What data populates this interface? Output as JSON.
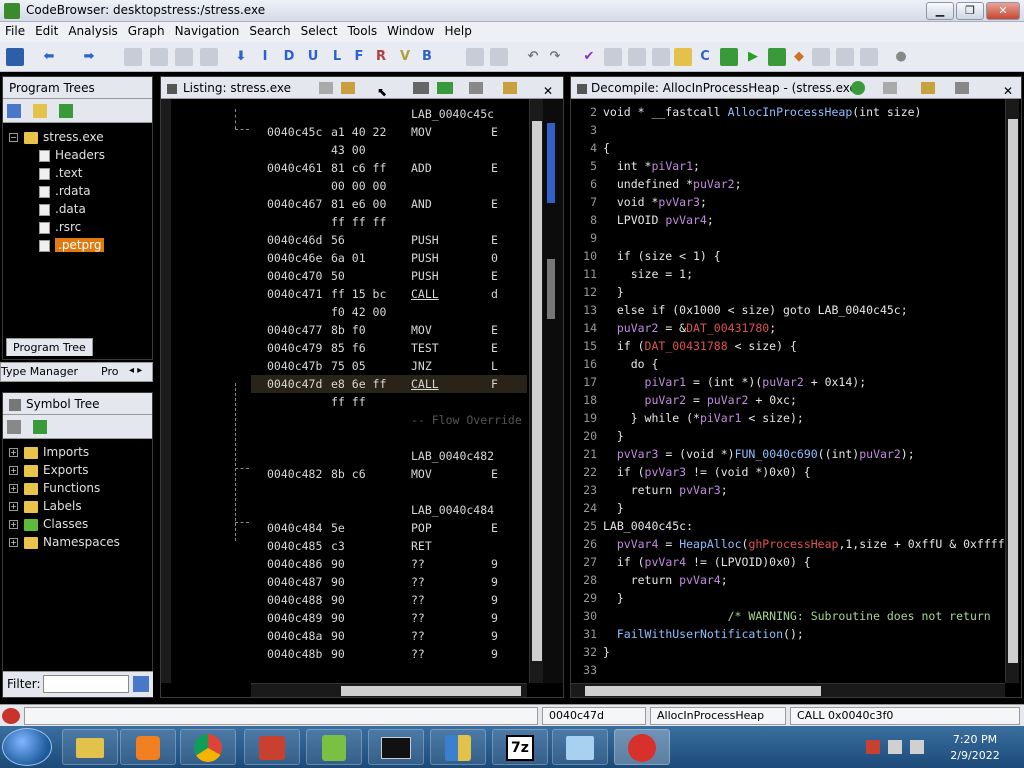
{
  "window": {
    "title": "CodeBrowser: desktopstress:/stress.exe",
    "min": "▁",
    "max": "❐",
    "close": "✕"
  },
  "menu": [
    "File",
    "Edit",
    "Analysis",
    "Graph",
    "Navigation",
    "Search",
    "Select",
    "Tools",
    "Window",
    "Help"
  ],
  "toolbar_letters": [
    "I",
    "D",
    "U",
    "L",
    "F",
    "R",
    "V",
    "B"
  ],
  "program_trees": {
    "title": "Program Trees",
    "root": "stress.exe",
    "items": [
      "Headers",
      ".text",
      ".rdata",
      ".data",
      ".rsrc",
      ".petprg"
    ],
    "tab": "Program Tree"
  },
  "type_manager": {
    "tab1": "Type Manager",
    "tab2": "Pro"
  },
  "symbol_tree": {
    "title": "Symbol Tree",
    "items": [
      "Imports",
      "Exports",
      "Functions",
      "Labels",
      "Classes",
      "Namespaces"
    ],
    "filter_label": "Filter:"
  },
  "listing": {
    "title": "Listing:  stress.exe",
    "rows": [
      {
        "addr": "",
        "bytes": "",
        "mnem": "LAB_0040c45c",
        "op": "",
        "label": true
      },
      {
        "addr": "0040c45c",
        "bytes": "a1 40 22",
        "mnem": "MOV",
        "op": "E"
      },
      {
        "addr": "",
        "bytes": "43 00",
        "mnem": "",
        "op": ""
      },
      {
        "addr": "0040c461",
        "bytes": "81 c6 ff",
        "mnem": "ADD",
        "op": "E"
      },
      {
        "addr": "",
        "bytes": "00 00 00",
        "mnem": "",
        "op": ""
      },
      {
        "addr": "0040c467",
        "bytes": "81 e6 00",
        "mnem": "AND",
        "op": "E"
      },
      {
        "addr": "",
        "bytes": "ff ff ff",
        "mnem": "",
        "op": ""
      },
      {
        "addr": "0040c46d",
        "bytes": "56",
        "mnem": "PUSH",
        "op": "E"
      },
      {
        "addr": "0040c46e",
        "bytes": "6a 01",
        "mnem": "PUSH",
        "op": "0"
      },
      {
        "addr": "0040c470",
        "bytes": "50",
        "mnem": "PUSH",
        "op": "E"
      },
      {
        "addr": "0040c471",
        "bytes": "ff 15 bc",
        "mnem": "CALL",
        "op": "d"
      },
      {
        "addr": "",
        "bytes": "f0 42 00",
        "mnem": "",
        "op": ""
      },
      {
        "addr": "0040c477",
        "bytes": "8b f0",
        "mnem": "MOV",
        "op": "E"
      },
      {
        "addr": "0040c479",
        "bytes": "85 f6",
        "mnem": "TEST",
        "op": "E"
      },
      {
        "addr": "0040c47b",
        "bytes": "75 05",
        "mnem": "JNZ",
        "op": "L"
      },
      {
        "addr": "0040c47d",
        "bytes": "e8 6e ff",
        "mnem": "CALL",
        "op": "F"
      },
      {
        "addr": "",
        "bytes": "ff ff",
        "mnem": "",
        "op": ""
      },
      {
        "addr": "",
        "bytes": "",
        "mnem": "-- Flow Override",
        "op": "",
        "comment": true
      },
      {
        "addr": "",
        "bytes": "",
        "mnem": "",
        "op": ""
      },
      {
        "addr": "",
        "bytes": "",
        "mnem": "LAB_0040c482",
        "op": "",
        "label": true
      },
      {
        "addr": "0040c482",
        "bytes": "8b c6",
        "mnem": "MOV",
        "op": "E"
      },
      {
        "addr": "",
        "bytes": "",
        "mnem": "",
        "op": ""
      },
      {
        "addr": "",
        "bytes": "",
        "mnem": "LAB_0040c484",
        "op": "",
        "label": true
      },
      {
        "addr": "0040c484",
        "bytes": "5e",
        "mnem": "POP",
        "op": "E"
      },
      {
        "addr": "0040c485",
        "bytes": "c3",
        "mnem": "RET",
        "op": ""
      },
      {
        "addr": "0040c486",
        "bytes": "90",
        "mnem": "??",
        "op": "9"
      },
      {
        "addr": "0040c487",
        "bytes": "90",
        "mnem": "??",
        "op": "9"
      },
      {
        "addr": "0040c488",
        "bytes": "90",
        "mnem": "??",
        "op": "9"
      },
      {
        "addr": "0040c489",
        "bytes": "90",
        "mnem": "??",
        "op": "9"
      },
      {
        "addr": "0040c48a",
        "bytes": "90",
        "mnem": "??",
        "op": "9"
      },
      {
        "addr": "0040c48b",
        "bytes": "90",
        "mnem": "??",
        "op": "9"
      }
    ]
  },
  "decompile": {
    "title": "Decompile: AllocInProcessHeap -  (stress.exe)",
    "lines": [
      {
        "n": "2",
        "html": "void * __fastcall <span class='fn'>AllocInProcessHeap</span>(int size)"
      },
      {
        "n": "3",
        "html": ""
      },
      {
        "n": "4",
        "html": "{"
      },
      {
        "n": "5",
        "html": "  int *<span class='var'>piVar1</span>;"
      },
      {
        "n": "6",
        "html": "  undefined *<span class='var'>puVar2</span>;"
      },
      {
        "n": "7",
        "html": "  void *<span class='var'>pvVar3</span>;"
      },
      {
        "n": "8",
        "html": "  LPVOID <span class='var'>pvVar4</span>;"
      },
      {
        "n": "9",
        "html": ""
      },
      {
        "n": "10",
        "html": "  if (size &lt; 1) {"
      },
      {
        "n": "11",
        "html": "    size = 1;"
      },
      {
        "n": "12",
        "html": "  }"
      },
      {
        "n": "13",
        "html": "  else if (0x1000 &lt; size) goto LAB_0040c45c;"
      },
      {
        "n": "14",
        "html": "  <span class='var'>puVar2</span> = &amp;<span class='glob'>DAT_00431780</span>;"
      },
      {
        "n": "15",
        "html": "  if (<span class='glob'>DAT_00431788</span> &lt; size) {"
      },
      {
        "n": "16",
        "html": "    do {"
      },
      {
        "n": "17",
        "html": "      <span class='var'>piVar1</span> = (int *)(<span class='var'>puVar2</span> + 0x14);"
      },
      {
        "n": "18",
        "html": "      <span class='var'>puVar2</span> = <span class='var'>puVar2</span> + 0xc;"
      },
      {
        "n": "19",
        "html": "    } while (*<span class='var'>piVar1</span> &lt; size);"
      },
      {
        "n": "20",
        "html": "  }"
      },
      {
        "n": "21",
        "html": "  <span class='var'>pvVar3</span> = (void *)<span class='fn'>FUN_0040c690</span>((int)<span class='var'>puVar2</span>);"
      },
      {
        "n": "22",
        "html": "  if (<span class='var'>pvVar3</span> != (void *)0x0) {"
      },
      {
        "n": "23",
        "html": "    return <span class='var'>pvVar3</span>;"
      },
      {
        "n": "24",
        "html": "  }"
      },
      {
        "n": "25",
        "html": "LAB_0040c45c:"
      },
      {
        "n": "26",
        "html": "  <span class='var'>pvVar4</span> = <span class='fn'>HeapAlloc</span>(<span class='glob'>ghProcessHeap</span>,1,size + 0xffU &amp; 0xffff"
      },
      {
        "n": "27",
        "html": "  if (<span class='var'>pvVar4</span> != (LPVOID)0x0) {"
      },
      {
        "n": "28",
        "html": "    return <span class='var'>pvVar4</span>;"
      },
      {
        "n": "29",
        "html": "  }"
      },
      {
        "n": "30",
        "html": "                  <span class='cmt'>/* WARNING: Subroutine does not return</span>"
      },
      {
        "n": "31",
        "html": "  <span class='fn'>FailWithUserNotification</span>();"
      },
      {
        "n": "32",
        "html": "}"
      },
      {
        "n": "33",
        "html": ""
      }
    ]
  },
  "status": {
    "address": "0040c47d",
    "function": "AllocInProcessHeap",
    "instruction": "CALL 0x0040c3f0"
  },
  "taskbar": {
    "time": "7:20 PM",
    "date": "2/9/2022",
    "app_7z": "7z"
  }
}
